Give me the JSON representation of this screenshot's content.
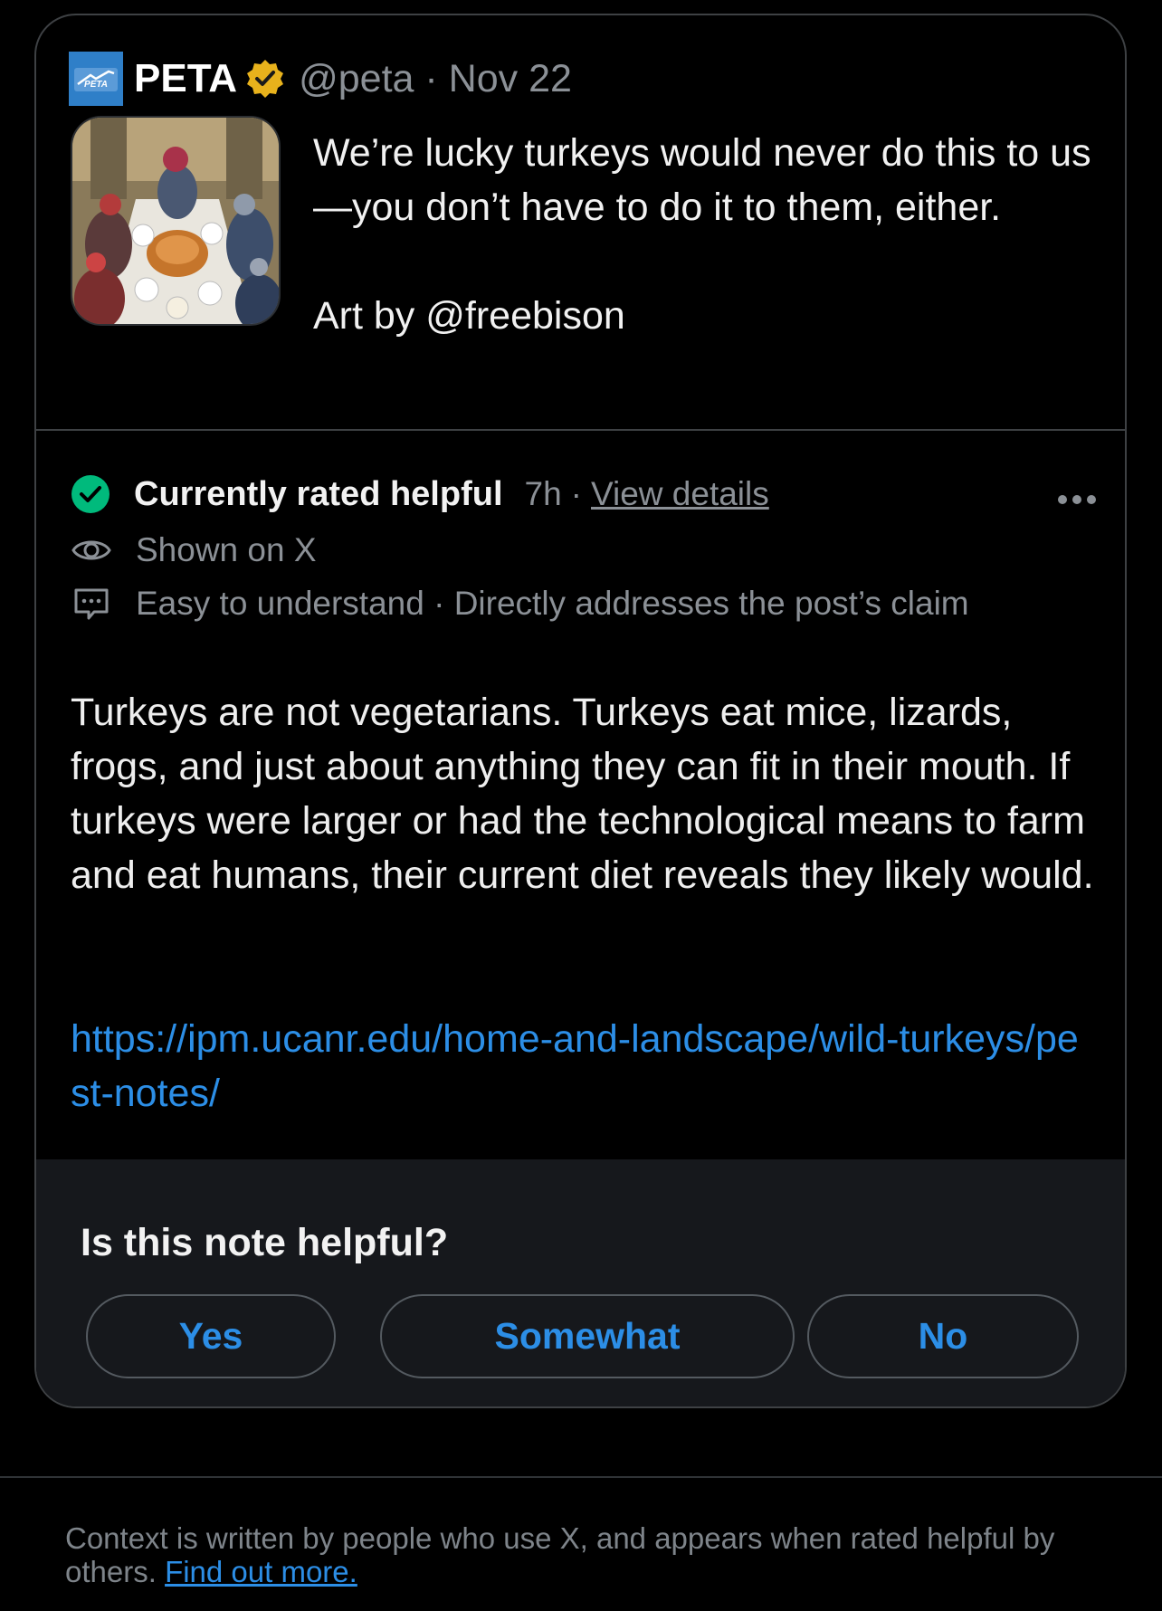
{
  "post": {
    "author_name": "PETA",
    "logo_text": "PETA",
    "handle": "@peta",
    "date": "Nov 22",
    "handle_date": "@peta · Nov 22",
    "text": "We’re lucky turkeys would never do this to us—you don’t have to do it to them, either.\n\nArt by @freebison",
    "verified_icon": "verified-badge-icon",
    "image": "turkeys-dinner-artwork"
  },
  "note": {
    "status_label": "Currently rated helpful",
    "time": "7h",
    "separator": "·",
    "view_details": "View details",
    "shown_on": "Shown on X",
    "tags": "Easy to understand · Directly addresses the post’s claim",
    "body": "Turkeys are not vegetarians. Turkeys eat mice, lizards, frogs, and just about anything they can fit in their mouth. If turkeys were larger or had the technological means to farm and eat humans, their current diet reveals they likely would.",
    "link": "https://ipm.ucanr.edu/home-and-landscape/wild-turkeys/pest-notes/"
  },
  "rating": {
    "question": "Is this note helpful?",
    "yes": "Yes",
    "somewhat": "Somewhat",
    "no": "No"
  },
  "footer": {
    "text": "Context is written by people who use X, and appears when rated helpful by others.",
    "link": "Find out more."
  },
  "colors": {
    "accent_blue": "#2c8ee6",
    "helpful_green": "#00ba7c",
    "verified_gold": "#e8b21c",
    "muted_text": "#8b9096"
  }
}
